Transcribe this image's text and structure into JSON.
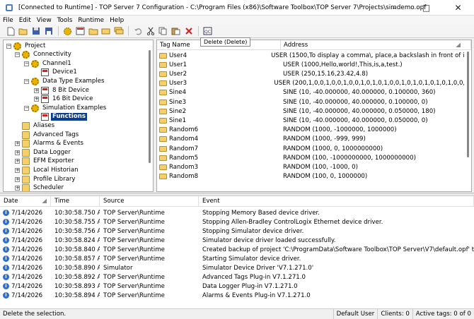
{
  "window": {
    "title": "[Connected to Runtime] - TOP Server 7 Configuration - C:\\Program Files (x86)\\Software Toolbox\\TOP Server 7\\Projects\\simdemo.opf"
  },
  "menu": [
    "File",
    "Edit",
    "View",
    "Tools",
    "Runtime",
    "Help"
  ],
  "toolbar": {
    "icons": [
      "new-icon",
      "open-icon",
      "save-icon",
      "save-as-icon",
      "new-channel-icon",
      "new-device-icon",
      "new-group-icon",
      "new-tag-icon",
      "bulk-tag-icon",
      "undo-icon",
      "cut-icon",
      "copy-icon",
      "paste-icon",
      "delete-icon",
      "quick-client-icon"
    ],
    "tooltip": "Delete (Delete)"
  },
  "tree": [
    {
      "label": "Project",
      "level": 0,
      "expander": "−",
      "icon": "project-icon"
    },
    {
      "label": "Connectivity",
      "level": 1,
      "expander": "−",
      "icon": "connectivity-icon"
    },
    {
      "label": "Channel1",
      "level": 2,
      "expander": "−",
      "icon": "channel-icon"
    },
    {
      "label": "Device1",
      "level": 3,
      "expander": "",
      "icon": "device-icon"
    },
    {
      "label": "Data Type Examples",
      "level": 2,
      "expander": "−",
      "icon": "channel-icon"
    },
    {
      "label": "8 Bit Device",
      "level": 3,
      "expander": "+",
      "icon": "device-icon"
    },
    {
      "label": "16 Bit Device",
      "level": 3,
      "expander": "+",
      "icon": "device-icon"
    },
    {
      "label": "Simulation Examples",
      "level": 2,
      "expander": "−",
      "icon": "channel-icon"
    },
    {
      "label": "Functions",
      "level": 3,
      "expander": "",
      "icon": "device-icon",
      "selected": true
    },
    {
      "label": "Aliases",
      "level": 1,
      "expander": "",
      "icon": "aliases-icon"
    },
    {
      "label": "Advanced Tags",
      "level": 1,
      "expander": "",
      "icon": "advanced-tags-icon"
    },
    {
      "label": "Alarms & Events",
      "level": 1,
      "expander": "+",
      "icon": "alarms-icon"
    },
    {
      "label": "Data Logger",
      "level": 1,
      "expander": "+",
      "icon": "data-logger-icon"
    },
    {
      "label": "EFM Exporter",
      "level": 1,
      "expander": "+",
      "icon": "efm-icon"
    },
    {
      "label": "Local Historian",
      "level": 1,
      "expander": "+",
      "icon": "historian-icon"
    },
    {
      "label": "Profile Library",
      "level": 1,
      "expander": "+",
      "icon": "profile-icon"
    },
    {
      "label": "Scheduler",
      "level": 1,
      "expander": "+",
      "icon": "scheduler-icon"
    }
  ],
  "tags": {
    "headers": {
      "name": "Tag Name",
      "address": "Address"
    },
    "rows": [
      {
        "name": "User4",
        "address": "USER (1500,To display a comma\\, place,a backslash in front of it.)"
      },
      {
        "name": "User1",
        "address": "USER (1000,Hello,world!,This,is,a,test.)"
      },
      {
        "name": "User2",
        "address": "USER (250,15.16,23.42,4.8)"
      },
      {
        "name": "User3",
        "address": "USER (200,1,0,0,1,0,0,1,0,0,1,0,1,0,1,0,0,1,0,1,0,1,0,1,0,1,0,0,0)"
      },
      {
        "name": "Sine4",
        "address": "SINE (10, -40.000000, 40.000000, 0.100000, 360)"
      },
      {
        "name": "Sine3",
        "address": "SINE (10, -40.000000, 40.000000, 0.100000, 0)"
      },
      {
        "name": "Sine2",
        "address": "SINE (10, -40.000000, 40.000000, 0.050000, 180)"
      },
      {
        "name": "Sine1",
        "address": "SINE (10, -40.000000, 40.000000, 0.050000, 0)"
      },
      {
        "name": "Random6",
        "address": "RANDOM (1000, -1000000, 1000000)"
      },
      {
        "name": "Random4",
        "address": "RANDOM (1000, -999, 999)"
      },
      {
        "name": "Random7",
        "address": "RANDOM (1000, 0, 1000000000)"
      },
      {
        "name": "Random5",
        "address": "RANDOM (100, -1000000000, 1000000000)"
      },
      {
        "name": "Random3",
        "address": "RANDOM (100, -1000, 0)"
      },
      {
        "name": "Random8",
        "address": "RANDOM (100, 0, 1000000)"
      }
    ]
  },
  "log": {
    "headers": {
      "date": "Date",
      "time": "Time",
      "source": "Source",
      "event": "Event"
    },
    "rows": [
      {
        "date": "7/14/2026",
        "time": "10:30:58.750 AM",
        "source": "TOP Server\\Runtime",
        "event": "Stopping Memory Based device driver."
      },
      {
        "date": "7/14/2026",
        "time": "10:30:58.755 AM",
        "source": "TOP Server\\Runtime",
        "event": "Stopping Allen-Bradley ControlLogix Ethernet device driver."
      },
      {
        "date": "7/14/2026",
        "time": "10:30:58.756 AM",
        "source": "TOP Server\\Runtime",
        "event": "Stopping Simulator device driver."
      },
      {
        "date": "7/14/2026",
        "time": "10:30:58.824 AM",
        "source": "TOP Server\\Runtime",
        "event": "Simulator device driver loaded successfully."
      },
      {
        "date": "7/14/2026",
        "time": "10:30:58.840 AM",
        "source": "TOP Server\\Runtime",
        "event": "Created backup of project 'C:\\ProgramData\\Software Toolbox\\TOP Server\\V7\\default.opf' to 'C:\\Prog"
      },
      {
        "date": "7/14/2026",
        "time": "10:30:58.857 AM",
        "source": "TOP Server\\Runtime",
        "event": "Starting Simulator device driver."
      },
      {
        "date": "7/14/2026",
        "time": "10:30:58.890 AM",
        "source": "Simulator",
        "event": "Simulator Device Driver 'V7.1.271.0'"
      },
      {
        "date": "7/14/2026",
        "time": "10:30:58.892 AM",
        "source": "TOP Server\\Runtime",
        "event": "Advanced Tags Plug-in V7.1.271.0"
      },
      {
        "date": "7/14/2026",
        "time": "10:30:58.893 AM",
        "source": "TOP Server\\Runtime",
        "event": "Data Logger Plug-in V7.1.271.0"
      },
      {
        "date": "7/14/2026",
        "time": "10:30:58.894 AM",
        "source": "TOP Server\\Runtime",
        "event": "Alarms & Events Plug-in V7.1.271.0"
      }
    ]
  },
  "status": {
    "message": "Delete the selection.",
    "user": "Default User",
    "clients": "Clients: 0",
    "active_tags": "Active tags: 0 of 0"
  },
  "colors": {
    "selection": "#0a3d91",
    "delete_icon": "#d02020",
    "info_icon": "#2b6fd0"
  }
}
